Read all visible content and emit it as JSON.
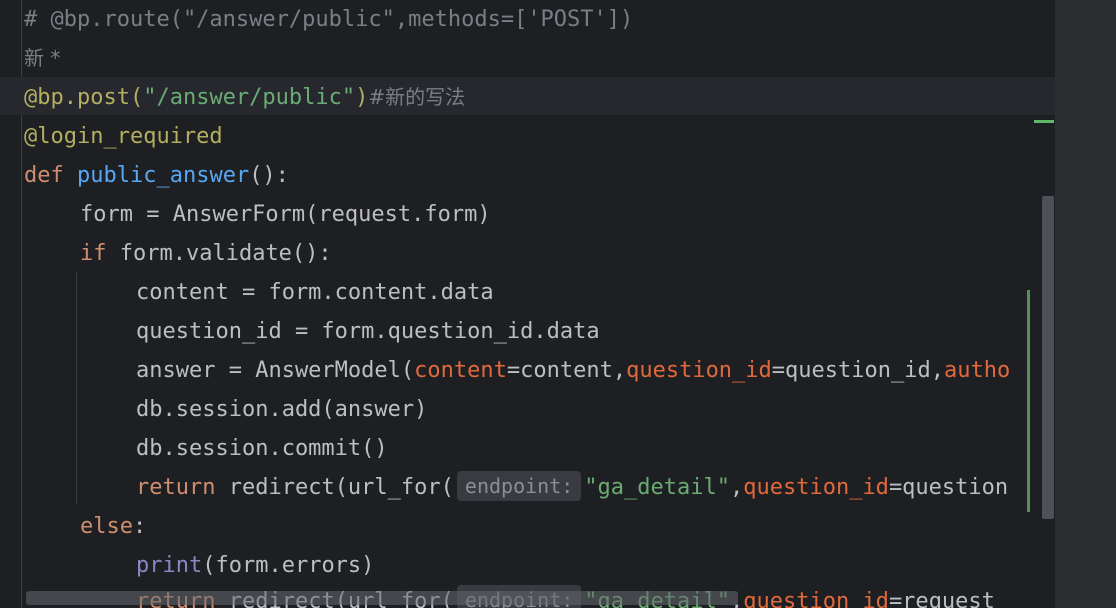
{
  "editor": {
    "lines": {
      "l1": {
        "text": "# @bp.route(\"/answer/public\",methods=['POST'])"
      },
      "l2": {
        "text": "新 *"
      },
      "l3": {
        "deco": "@bp.post(",
        "str": "\"/answer/public\"",
        "close": ")",
        "comment": "#新的写法"
      },
      "l4": {
        "deco": "@login_required"
      },
      "l5": {
        "kw": "def",
        "fn": "public_answer",
        "rest": "():"
      },
      "l6": {
        "text": "form = AnswerForm(request.form)"
      },
      "l7": {
        "kw": "if",
        "rest": " form.validate():"
      },
      "l8": {
        "text": "content = form.content.data"
      },
      "l9": {
        "text": "question_id = form.question_id.data"
      },
      "l10": {
        "a": "answer = AnswerModel(",
        "p1": "content",
        "b": "=content,",
        "p2": "question_id",
        "c": "=question_id,",
        "p3": "autho"
      },
      "l11": {
        "text": "db.session.add(answer)"
      },
      "l12": {
        "text": "db.session.commit()"
      },
      "l13": {
        "kw": "return",
        "a": " redirect(url_for(",
        "hint": "endpoint:",
        "str": "\"ga_detail\"",
        "b": ",",
        "p": "question_id",
        "c": "=question"
      },
      "l14": {
        "kw": "else",
        "rest": ":"
      },
      "l15": {
        "builtin": "print",
        "rest": "(form.errors)"
      },
      "l16": {
        "kw": "return",
        "a": " redirect(url_for(",
        "hint": "endpoint:",
        "str": "\"ga_detail\"",
        "b": ",",
        "p": "question_id",
        "c": "=request"
      }
    }
  }
}
